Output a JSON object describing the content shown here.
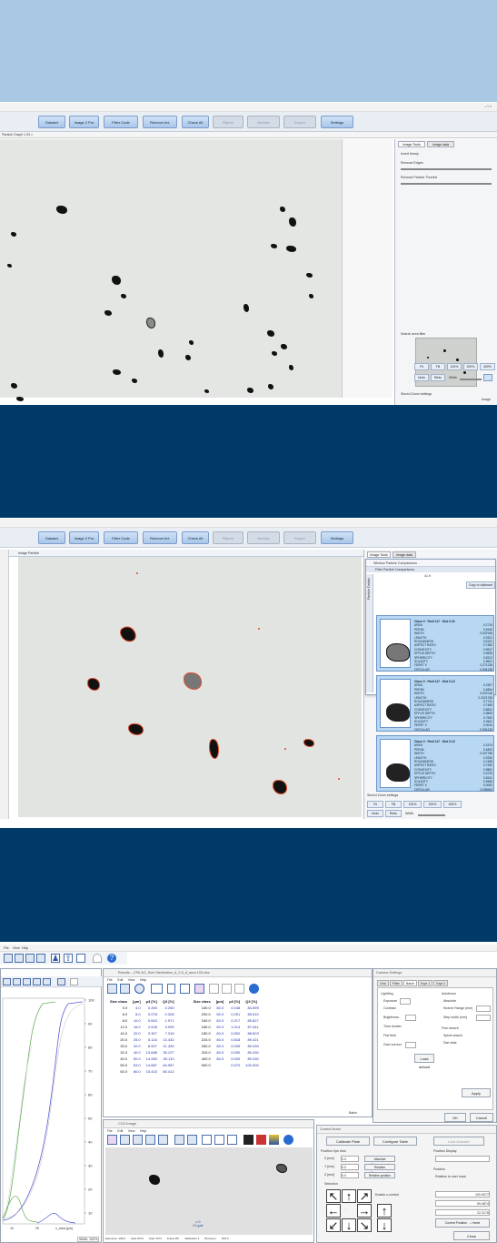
{
  "section1": {
    "window_controls": "–  □  ×",
    "toolbar": [
      {
        "label": "Dataset",
        "disabled": false
      },
      {
        "label": "Image 2 Pro",
        "disabled": false
      },
      {
        "label": "Filter Code",
        "disabled": false
      },
      {
        "label": "Remove Art.",
        "disabled": false
      },
      {
        "label": "Check All",
        "disabled": false
      },
      {
        "label": "Report",
        "disabled": true
      },
      {
        "label": "Archive",
        "disabled": true
      },
      {
        "label": "Export",
        "disabled": true
      },
      {
        "label": "Settings",
        "disabled": false
      }
    ],
    "doc_tab": "Particle Graph 1.03 ×",
    "panel_tabs": [
      "Image Tools",
      "Image data"
    ],
    "panel_rows": [
      "Invert binary",
      "Remove Edges",
      "Remove Particle Thumbs"
    ],
    "overview_label": "Search area filter",
    "view_settings_label": "Stored Zoom settings",
    "zoom_buttons": [
      "Fit",
      "Fill",
      "100%",
      "200%",
      "400%"
    ],
    "bottom_buttons": [
      "Undo",
      "Redo",
      "Width"
    ],
    "status_right": "Image"
  },
  "section2": {
    "toolbar": [
      {
        "label": "Dataset",
        "disabled": false
      },
      {
        "label": "Image 2 Pro",
        "disabled": false
      },
      {
        "label": "Filter Code",
        "disabled": false
      },
      {
        "label": "Remove Art.",
        "disabled": false
      },
      {
        "label": "Check All",
        "disabled": false
      },
      {
        "label": "Report",
        "disabled": true
      },
      {
        "label": "Archive",
        "disabled": true
      },
      {
        "label": "Export",
        "disabled": true
      },
      {
        "label": "Settings",
        "disabled": false
      }
    ],
    "doc_tab": "Image Particle",
    "panel_tabs": [
      "Image Tools",
      "Image data"
    ],
    "popup_title": "Window Particle Comparisons",
    "popup_sub": "Filter Particle Comparisons",
    "popup_value": "41.9",
    "popup_btn": "Copy to clipboard",
    "side_tab": "Particle Details",
    "cards": [
      {
        "header": "Class 0 · Parti 117 · Dist 0.03",
        "rows": [
          [
            "AREA",
            "0.2715"
          ],
          [
            "PERIM",
            "0.4940"
          ],
          [
            "WIDTH",
            "0.537946"
          ],
          [
            "LENGTH",
            "0.3321"
          ],
          [
            "ROUNDNESS",
            "0.6761"
          ],
          [
            "ASPECT RATIO",
            "0.7382"
          ],
          [
            "CONVEXITY",
            "0.9947"
          ],
          [
            "EFFUS DEPTH",
            "0.9839"
          ],
          [
            "SPHERICITY",
            "0.8312"
          ],
          [
            "SOLIDITY",
            "0.9601"
          ],
          [
            "FERET X",
            "0.271136"
          ],
          [
            "CIRCULAR",
            "0.534138"
          ]
        ]
      },
      {
        "header": "Class 0 · Parti 117 · Dist 0.13",
        "rows": [
          [
            "AREA",
            "0.2307"
          ],
          [
            "PERIM",
            "0.4864"
          ],
          [
            "WIDTH",
            "0.537046"
          ],
          [
            "LENGTH",
            "0.3321706"
          ],
          [
            "ROUNDNESS",
            "0.7731"
          ],
          [
            "ASPECT RATIO",
            "0.7480"
          ],
          [
            "CONVEXITY",
            "0.8831"
          ],
          [
            "EFFUS DEPTH",
            "0.9805"
          ],
          [
            "SPHERICITY",
            "0.7952"
          ],
          [
            "SOLIDITY",
            "0.9611"
          ],
          [
            "FERET X",
            "0.0044"
          ],
          [
            "CIRCULAR",
            "0.534138"
          ]
        ]
      },
      {
        "header": "Class 0 · Parti 117 · Dist 0.10",
        "rows": [
          [
            "AREA",
            "0.1574"
          ],
          [
            "PERIM",
            "0.4802"
          ],
          [
            "WIDTH",
            "0.537786"
          ],
          [
            "LENGTH",
            "0.3330"
          ],
          [
            "ROUNDNESS",
            "0.7486"
          ],
          [
            "ASPECT RATIO",
            "0.7260"
          ],
          [
            "CONVEXITY",
            "0.9881"
          ],
          [
            "EFFUS DEPTH",
            "0.9720"
          ],
          [
            "SPHERICITY",
            "0.8341"
          ],
          [
            "SOLIDITY",
            "0.9566"
          ],
          [
            "FERET X",
            "0.0062"
          ],
          [
            "CIRCULAR",
            "0.538906"
          ]
        ]
      }
    ],
    "view_settings_label": "Stored Zoom settings",
    "zoom_buttons": [
      "Fit",
      "Fill",
      "100%",
      "200%",
      "400%"
    ],
    "bottom_buttons": [
      "Undo",
      "Redo",
      "Width"
    ]
  },
  "section3": {
    "menu": [
      "File",
      "View",
      "Help"
    ],
    "results_title": "Results – CPA 3/2_Size Distribution_d_0.5_d_area 103.xlsx",
    "results_menu": [
      "File",
      "Edit",
      "View",
      "Help"
    ],
    "table_headers": [
      "Size class",
      "[µm]",
      "p3 [%]",
      "Q3 [%]",
      "Size class",
      "[µm]",
      "p3 [%]",
      "Q3 [%]"
    ],
    "table_rows": [
      [
        "0.0",
        "4.0",
        "0.250",
        "0.250",
        "160.0",
        "80.0",
        "0.048",
        "84.599"
      ],
      [
        "6.0",
        "8.0",
        "0.078",
        "0.328",
        "200.0",
        "50.0",
        "0.051",
        "85.610"
      ],
      [
        "8.0",
        "10.0",
        "0.643",
        "1.971",
        "160.0",
        "60.0",
        "0.217",
        "85.827"
      ],
      [
        "12.0",
        "16.0",
        "2.028",
        "3.999",
        "180.0",
        "60.0",
        "1.014",
        "87.041"
      ],
      [
        "16.0",
        "20.0",
        "3.307",
        "7.316",
        "180.0",
        "60.0",
        "0.552",
        "88.603"
      ],
      [
        "20.0",
        "25.0",
        "6.116",
        "13.432",
        "224.0",
        "80.0",
        "0.818",
        "89.421"
      ],
      [
        "25.0",
        "32.0",
        "8.007",
        "21.439",
        "250.0",
        "80.0",
        "0.009",
        "89.430"
      ],
      [
        "32.0",
        "40.0",
        "13.688",
        "35.127",
        "315.0",
        "80.0",
        "0.000",
        "89.430"
      ],
      [
        "40.0",
        "50.0",
        "14.983",
        "50.110",
        "400.0",
        "80.0",
        "0.000",
        "89.430"
      ],
      [
        "50.0",
        "63.0",
        "14.887",
        "64.997",
        "500.0",
        "",
        "0.570",
        "100.000"
      ],
      [
        "63.0",
        "80.0",
        "15.415",
        "80.412",
        "",
        "",
        "",
        ""
      ]
    ],
    "results_foot": "Batch",
    "graph_axis_label": "x_area [µm]",
    "graph_ticks_x": [
      "10",
      "20"
    ],
    "graph_ticks_y": [
      "100",
      "90",
      "80",
      "70",
      "60",
      "50",
      "40",
      "30",
      "20",
      "10"
    ],
    "graph_status": "Width: 100%",
    "cam_title": "CCD Image",
    "cam_menu": [
      "File",
      "Edit",
      "View",
      "Help"
    ],
    "cam_status": [
      "Exposure: 100%",
      "Gain 8474",
      "Gain 3374",
      "Frame 80",
      "Calibration 1",
      "Binning 1",
      "Roll 6"
    ],
    "cam_center": "x=0\n1% gate",
    "settings_title": "Camera Settings",
    "settings_tabs": [
      "Grid",
      "Filter",
      "Batch",
      "Expt 1",
      "Expt 2"
    ],
    "settings_labels": [
      "Lightting",
      "Exposure",
      "Contrast",
      "Brightness",
      "Time shutter",
      "Flat field",
      "Gain correct"
    ],
    "settings_right": [
      "Autofocus",
      "Absolute",
      "Search Range (mm)",
      "Step width (mm)",
      "Fine search",
      "Spiral search",
      "Dist slide"
    ],
    "settings_btns": [
      "Load default",
      "Apply",
      "OK",
      "Cancel"
    ],
    "control_title": "Control Motor",
    "ctrl_btns": [
      "Calibrate Plate",
      "Configure Table",
      "Lock Actuator"
    ],
    "ctrl_labels": [
      "Position Xpe Axis",
      "X [mm]",
      "Y [mm]",
      "Z [mm]",
      "Selection",
      "Enable x-control",
      "Absolute Measurement",
      "Relative Measurement",
      "Relative position",
      "Position Display",
      "Position",
      "Relative to user locat."
    ],
    "ctrl_fields": [
      "0.0",
      "0.0",
      "0.0"
    ],
    "ctrl_readouts": [
      "100.9077",
      "99.4874",
      "22.3176"
    ],
    "ctrl_bottom": [
      "Current Position → Home",
      "Close"
    ]
  }
}
